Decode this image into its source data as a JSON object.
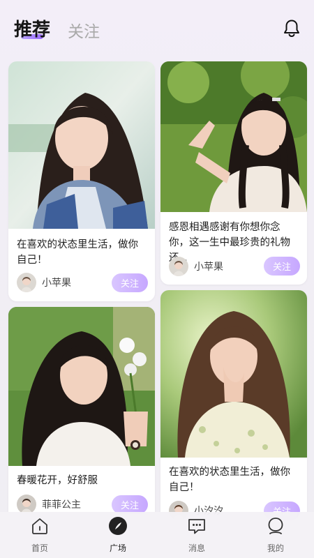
{
  "header": {
    "tab_recommend": "推荐",
    "tab_follow": "关注",
    "notification_icon": "bell-icon"
  },
  "feed": [
    {
      "caption": "在喜欢的状态里生活，做你自己！",
      "author": "小苹果",
      "follow_label": "关注"
    },
    {
      "caption": "感恩相遇感谢有你想你念你，这一生中最珍贵的礼物还...",
      "author": "小苹果",
      "follow_label": "关注"
    },
    {
      "caption": "春暖花开，好舒服",
      "author": "菲菲公主",
      "follow_label": "关注"
    },
    {
      "caption": "在喜欢的状态里生活，做你自己！",
      "author": "小汐汐",
      "follow_label": "关注"
    }
  ],
  "nav": {
    "items": [
      {
        "label": "首页",
        "icon": "home-icon"
      },
      {
        "label": "广场",
        "icon": "compass-icon"
      },
      {
        "label": "消息",
        "icon": "message-icon"
      },
      {
        "label": "我的",
        "icon": "profile-icon"
      }
    ],
    "active_index": 1
  },
  "colors": {
    "accent": "#c6a7ff",
    "text": "#1e1e1e",
    "background": "#f2eff6"
  }
}
